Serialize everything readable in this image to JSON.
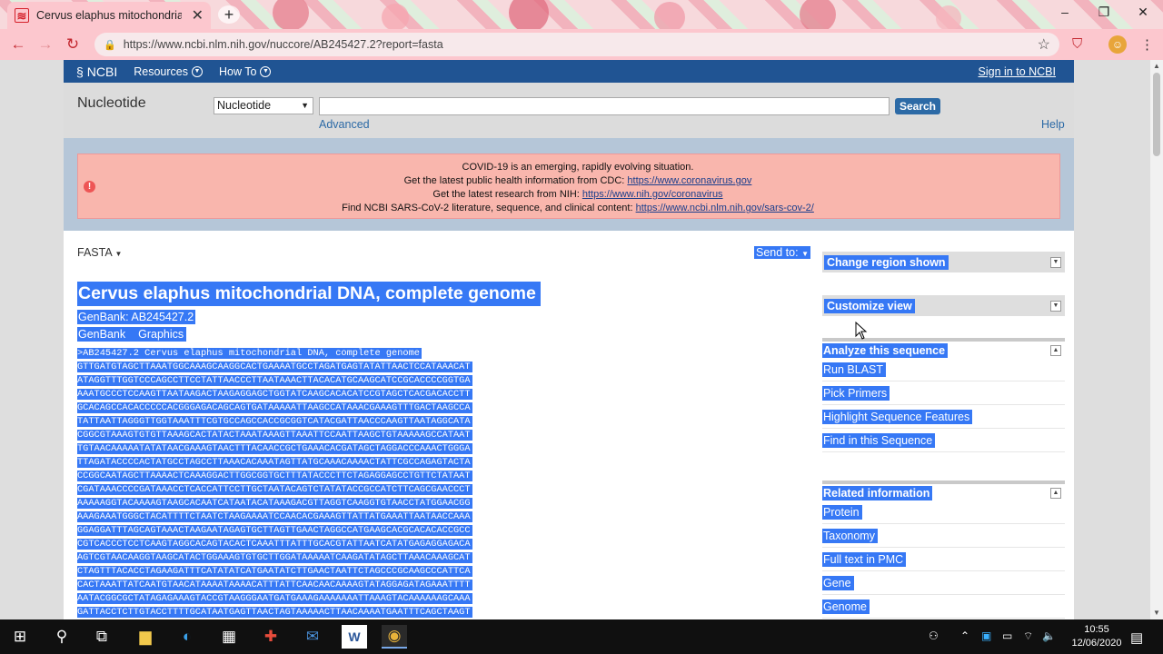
{
  "browser": {
    "tab_title": "Cervus elaphus mitochondrial DNA, complete genome",
    "tab_favicon": "NCBI",
    "new_tab_symbol": "+",
    "url": "https://www.ncbi.nlm.nih.gov/nuccore/AB245427.2?report=fasta",
    "accent": "#c2262e"
  },
  "ncbi_bar": {
    "logo": "NCBI",
    "resources": "Resources",
    "how_to": "How To",
    "sign_in": "Sign in to NCBI"
  },
  "search": {
    "db_name": "Nucleotide",
    "db_selected": "Nucleotide",
    "query_value": "",
    "search_button": "Search",
    "advanced": "Advanced",
    "help": "Help"
  },
  "alert": {
    "lines": [
      {
        "text": "COVID-19 is an emerging, rapidly evolving situation.",
        "link": ""
      },
      {
        "text": "Get the latest public health information from CDC: ",
        "link": "https://www.coronavirus.gov"
      },
      {
        "text": "Get the latest research from NIH: ",
        "link": "https://www.nih.gov/coronavirus"
      },
      {
        "text": "Find NCBI SARS-CoV-2 literature, sequence, and clinical content: ",
        "link": "https://www.ncbi.nlm.nih.gov/sars-cov-2/"
      }
    ]
  },
  "record": {
    "format": "FASTA",
    "send_to": "Send to:",
    "title": "Cervus elaphus mitochondrial DNA, complete genome",
    "accession_line": "GenBank: AB245427.2",
    "link_genbank": "GenBank",
    "link_graphics": "Graphics",
    "fasta_header": ">AB245427.2 Cervus elaphus mitochondrial DNA, complete genome",
    "sequence_lines": [
      "GTTGATGTAGCTTAAATGGCAAAGCAAGGCACTGAAAATGCCTAGATGAGTATATTAACTCCATAAACAT",
      "ATAGGTTTGGTCCCAGCCTTCCTATTAACCCTTAATAAACTTACACATGCAAGCATCCGCACCCCGGTGA",
      "AAATGCCCTCCAAGTTAATAAGACTAAGAGGAGCTGGTATCAAGCACACATCCGTAGCTCACGACACCTT",
      "GCACAGCCACACCCCCACGGGAGACAGCAGTGATAAAAATTAAGCCATAAACGAAAGTTTGACTAAGCCA",
      "TATTAATTAGGGTTGGTAAATTTCGTGCCAGCCACCGCGGTCATACGATTAACCCAAGTTAATAGGCATA",
      "CGGCGTAAAGTGTGTTAAAGCACTATACTAAATAAAGTTAAATTCCAATTAAGCTGTAAAAAGCCATAAT",
      "TGTAACAAAAATATATAACGAAAGTAACTTTACAACCGCTGAAACACGATAGCTAGGACCCAAACTGGGA",
      "TTAGATACCCCACTATGCCTAGCCTTAAACACAAATAGTTATGCAAACAAAACTATTCGCCAGAGTACTA",
      "CCGGCAATAGCTTAAAACTCAAAGGACTTGGCGGTGCTTTATACCCTTCTAGAGGAGCCTGTTCTATAAT",
      "CGATAAACCCCGATAAACCTCACCATTCCTTGCTAATACAGTCTATATACCGCCATCTTCAGCGAACCCT",
      "AAAAAGGTACAAAAGTAAGCACAATCATAATACATAAAGACGTTAGGTCAAGGTGTAACCTATGGAACGG",
      "AAAGAAATGGGCTACATTTTCTAATCTAAGAAAATCCAACACGAAAGTTATTATGAAATTAATAACCAAA",
      "GGAGGATTTAGCAGTAAACTAAGAATAGAGTGCTTAGTTGAACTAGGCCATGAAGCACGCACACACCGCC",
      "CGTCACCCTCCTCAAGTAGGCACAGTACACTCAAATTTATTTGCACGTATTAATCATATGAGAGGAGACA",
      "AGTCGTAACAAGGTAAGCATACTGGAAAGTGTGCTTGGATAAAAATCAAGATATAGCTTAAACAAAGCAT",
      "CTAGTTTACACCTAGAAGATTTCATATATCATGAATATCTTGAACTAATTCTAGCCCGCAAGCCCATTCA",
      "CACTAAATTATCAATGTAACATAAAATAAAACATTTATTCAACAACAAAAGTATAGGAGATAGAAATTTT",
      "AATACGGCGCTATAGAGAAAGTACCGTAAGGGAATGATGAAAGAAAAAAATTAAAGTACAAAAAAGCAAA",
      "GATTACCTCTTGTACCTTTTGCATAATGAGTTAACTAGTAAAAACTTAACAAAATGAATTTCAGCTAAGT"
    ]
  },
  "sidebar": {
    "change_region": "Change region shown",
    "customize_view": "Customize view",
    "analyze": {
      "heading": "Analyze this sequence",
      "links": [
        "Run BLAST",
        "Pick Primers",
        "Highlight Sequence Features",
        "Find in this Sequence"
      ]
    },
    "related": {
      "heading": "Related information",
      "links": [
        "Protein",
        "Taxonomy",
        "Full text in PMC",
        "Gene",
        "Genome"
      ]
    }
  },
  "taskbar": {
    "time": "10:55",
    "date": "12/06/2020"
  },
  "colors": {
    "selection": "#3678f5",
    "ncbi_blue": "#205493",
    "alert_bg": "#f9b6ad"
  }
}
